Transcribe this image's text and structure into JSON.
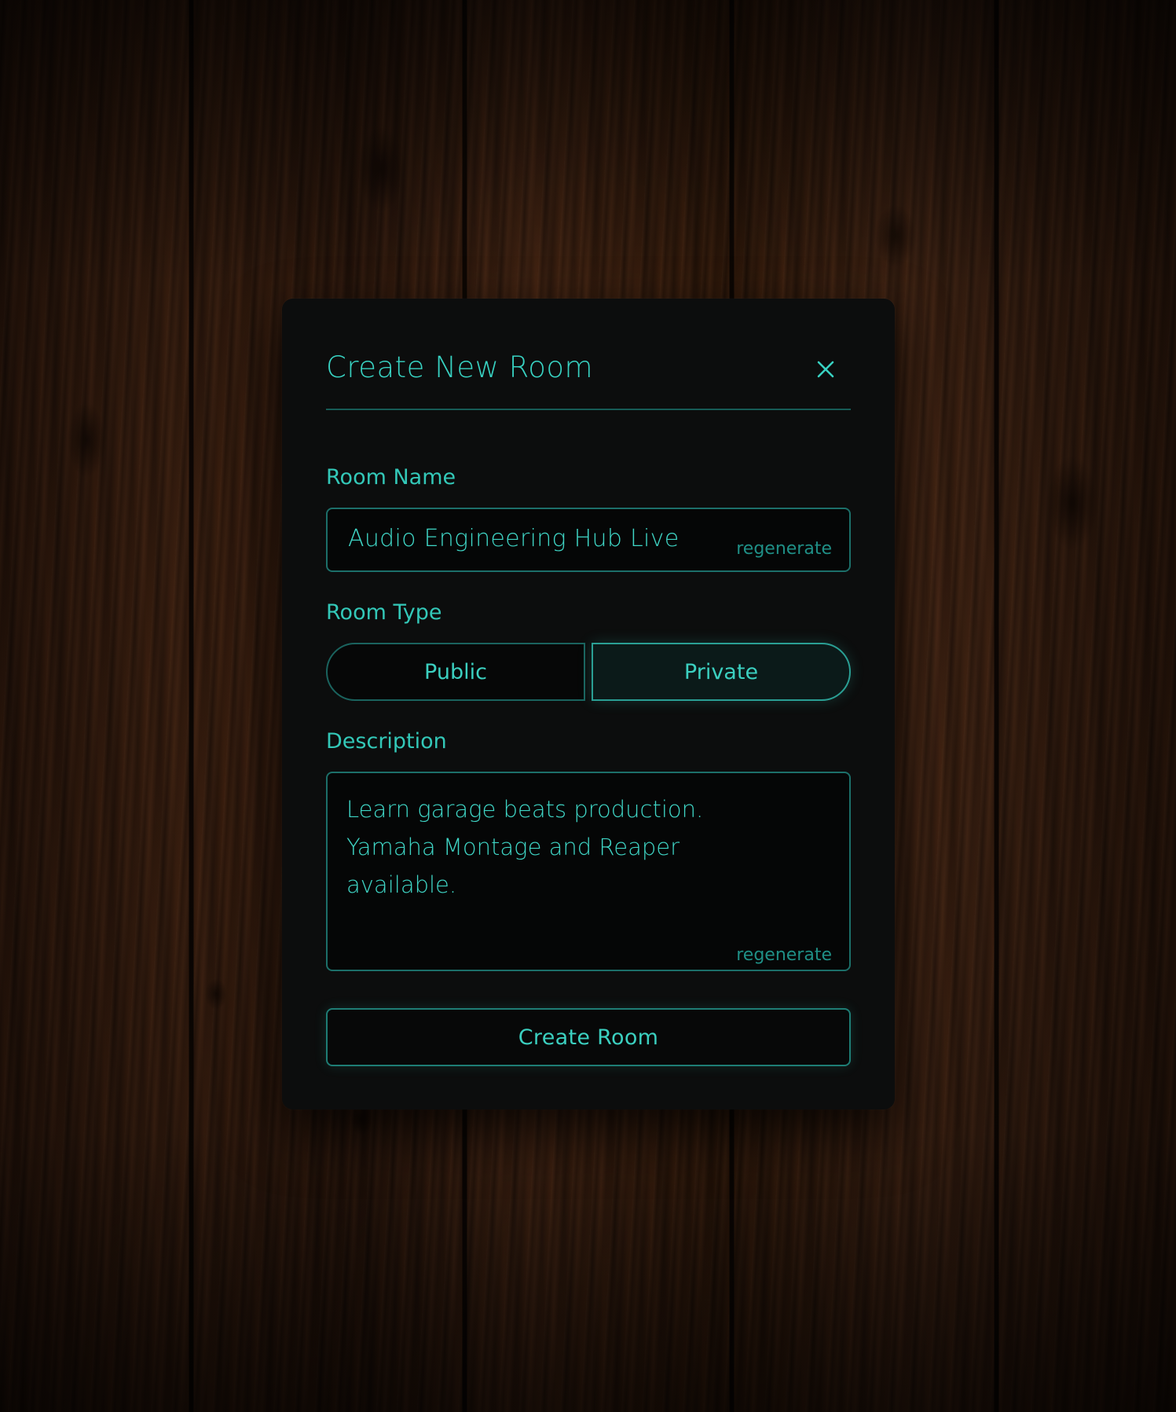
{
  "modal": {
    "title": "Create New Room",
    "close_icon": "close-icon"
  },
  "room_name": {
    "label": "Room Name",
    "value": "Audio Engineering Hub Live",
    "regenerate_label": "regenerate"
  },
  "room_type": {
    "label": "Room Type",
    "options": [
      "Public",
      "Private"
    ],
    "selected": "Private"
  },
  "description": {
    "label": "Description",
    "value": "Learn garage beats production. Yamaha Montage and Reaper available.",
    "regenerate_label": "regenerate"
  },
  "actions": {
    "create_label": "Create Room"
  },
  "colors": {
    "accent": "#38d2c2",
    "border": "#1c6f69",
    "modal_bg": "#0c0d0d"
  }
}
